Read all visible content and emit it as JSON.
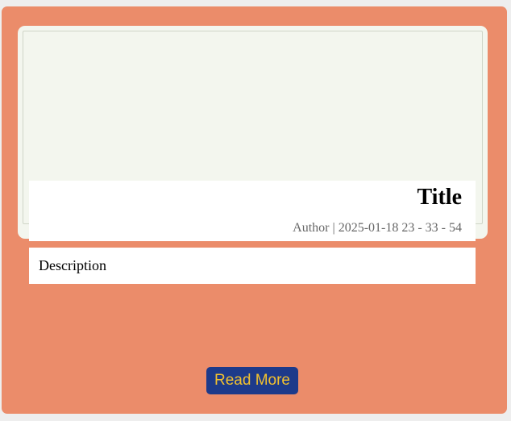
{
  "card": {
    "title": "Title",
    "author": "Author",
    "separator": " | ",
    "timestamp": "2025-01-18 23 - 33 - 54",
    "description": "Description",
    "button_label": "Read More"
  },
  "colors": {
    "card_background": "#eb8c6a",
    "image_placeholder": "#f3f6ee",
    "button_background": "#1d3a8a",
    "button_text": "#f2c12e"
  }
}
